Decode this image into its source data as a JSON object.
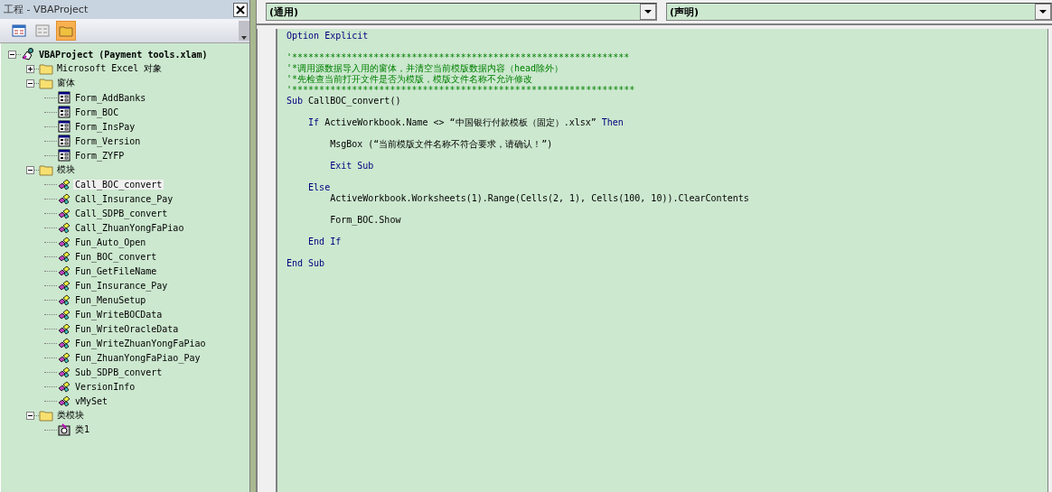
{
  "project_pane": {
    "title": "工程 - VBAProject",
    "toolbar": [
      {
        "kind": "view-code",
        "selected": false
      },
      {
        "kind": "view-object",
        "selected": false
      },
      {
        "kind": "toggle-folders",
        "selected": true
      }
    ],
    "tree": [
      {
        "label": "VBAProject (Payment tools.xlam)",
        "kind": "project",
        "expanded": true,
        "selected": false,
        "children": [
          {
            "label": "Microsoft Excel 对象",
            "kind": "folder",
            "expanded": false,
            "selected": false
          },
          {
            "label": "窗体",
            "kind": "folder",
            "expanded": true,
            "selected": false,
            "children": [
              {
                "label": "Form_AddBanks",
                "kind": "form",
                "selected": false
              },
              {
                "label": "Form_BOC",
                "kind": "form",
                "selected": false
              },
              {
                "label": "Form_InsPay",
                "kind": "form",
                "selected": false
              },
              {
                "label": "Form_Version",
                "kind": "form",
                "selected": false
              },
              {
                "label": "Form_ZYFP",
                "kind": "form",
                "selected": false
              }
            ]
          },
          {
            "label": "模块",
            "kind": "folder",
            "expanded": true,
            "selected": false,
            "children": [
              {
                "label": "Call_BOC_convert",
                "kind": "module",
                "selected": true
              },
              {
                "label": "Call_Insurance_Pay",
                "kind": "module",
                "selected": false
              },
              {
                "label": "Call_SDPB_convert",
                "kind": "module",
                "selected": false
              },
              {
                "label": "Call_ZhuanYongFaPiao",
                "kind": "module",
                "selected": false
              },
              {
                "label": "Fun_Auto_Open",
                "kind": "module",
                "selected": false
              },
              {
                "label": "Fun_BOC_convert",
                "kind": "module",
                "selected": false
              },
              {
                "label": "Fun_GetFileName",
                "kind": "module",
                "selected": false
              },
              {
                "label": "Fun_Insurance_Pay",
                "kind": "module",
                "selected": false
              },
              {
                "label": "Fun_MenuSetup",
                "kind": "module",
                "selected": false
              },
              {
                "label": "Fun_WriteBOCData",
                "kind": "module",
                "selected": false
              },
              {
                "label": "Fun_WriteOracleData",
                "kind": "module",
                "selected": false
              },
              {
                "label": "Fun_WriteZhuanYongFaPiao",
                "kind": "module",
                "selected": false
              },
              {
                "label": "Fun_ZhuanYongFaPiao_Pay",
                "kind": "module",
                "selected": false
              },
              {
                "label": "Sub_SDPB_convert",
                "kind": "module",
                "selected": false
              },
              {
                "label": "VersionInfo",
                "kind": "module",
                "selected": false
              },
              {
                "label": "vMySet",
                "kind": "module",
                "selected": false
              }
            ]
          },
          {
            "label": "类模块",
            "kind": "folder",
            "expanded": true,
            "selected": false,
            "children": [
              {
                "label": "类1",
                "kind": "class",
                "selected": false
              }
            ]
          }
        ]
      }
    ]
  },
  "code_window": {
    "object_dropdown": "(通用)",
    "procedure_dropdown": "(声明)",
    "lines": [
      {
        "kind": "code",
        "segments": [
          {
            "kind": "keyword",
            "text": "Option Explicit"
          }
        ]
      },
      {
        "kind": "blank"
      },
      {
        "kind": "code",
        "segments": [
          {
            "kind": "comment",
            "text": "'**************************************************************"
          }
        ]
      },
      {
        "kind": "code",
        "segments": [
          {
            "kind": "comment",
            "text": "'*调用源数据导入用的窗体，并清空当前模版数据内容（head除外）"
          }
        ]
      },
      {
        "kind": "code",
        "segments": [
          {
            "kind": "comment",
            "text": "'*先检查当前打开文件是否为模版，模版文件名称不允许修改"
          }
        ]
      },
      {
        "kind": "code",
        "segments": [
          {
            "kind": "comment",
            "text": "'***************************************************************"
          }
        ]
      },
      {
        "kind": "code",
        "segments": [
          {
            "kind": "keyword",
            "text": "Sub"
          },
          {
            "kind": "plain",
            "text": " CallBOC_convert()"
          }
        ]
      },
      {
        "kind": "blank"
      },
      {
        "kind": "code",
        "segments": [
          {
            "kind": "keyword",
            "text": "    If"
          },
          {
            "kind": "plain",
            "text": " ActiveWorkbook.Name <> “中国银行付款模板（固定）.xlsx”"
          },
          {
            "kind": "keyword",
            "text": " Then"
          }
        ]
      },
      {
        "kind": "blank"
      },
      {
        "kind": "code",
        "segments": [
          {
            "kind": "plain",
            "text": "        MsgBox (“当前模版文件名称不符合要求，请确认！”)"
          }
        ]
      },
      {
        "kind": "blank"
      },
      {
        "kind": "code",
        "segments": [
          {
            "kind": "keyword",
            "text": "        Exit Sub"
          }
        ]
      },
      {
        "kind": "blank"
      },
      {
        "kind": "code",
        "segments": [
          {
            "kind": "keyword",
            "text": "    Else"
          }
        ]
      },
      {
        "kind": "code",
        "segments": [
          {
            "kind": "plain",
            "text": "        ActiveWorkbook.Worksheets(1).Range(Cells(2, 1), Cells(100, 10)).ClearContents"
          }
        ]
      },
      {
        "kind": "blank"
      },
      {
        "kind": "code",
        "segments": [
          {
            "kind": "plain",
            "text": "        Form_BOC.Show"
          }
        ]
      },
      {
        "kind": "blank"
      },
      {
        "kind": "code",
        "segments": [
          {
            "kind": "keyword",
            "text": "    End If"
          }
        ]
      },
      {
        "kind": "blank"
      },
      {
        "kind": "code",
        "segments": [
          {
            "kind": "keyword",
            "text": "End Sub"
          }
        ]
      }
    ]
  }
}
